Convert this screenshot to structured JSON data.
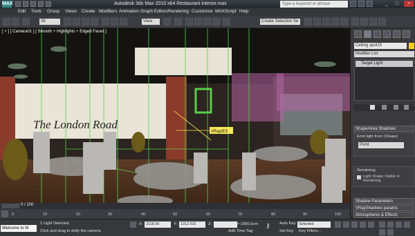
{
  "window": {
    "title": "Autodesk 3ds Max  2010 x64      Restaurant interior.max",
    "search_placeholder": "Type a keyword or phrase",
    "logo_label": "MAX"
  },
  "menu": [
    "Edit",
    "Tools",
    "Group",
    "Views",
    "Create",
    "Modifiers",
    "Animation",
    "Graph Editors",
    "Rendering",
    "Customize",
    "MAXScript",
    "Help"
  ],
  "toolbar": {
    "selection_filter": "All",
    "reference_coord": "View",
    "named_selection": "Create Selection Se"
  },
  "viewport": {
    "label": "[ + ] [ Camera01 ] [ Smooth + Highlights + Edged Faces ]",
    "sign_text": "The London Road",
    "object_tag": "VRayIES"
  },
  "command_panel": {
    "object_name": "Ceiling spot15",
    "modifier_list": "Modifier List",
    "stack_item": "Target Light",
    "rollouts": {
      "shape_area_shadows": "Shape/Area Shadows",
      "emit_light_from": "Emit light from (Shape)",
      "shape_type": "Point",
      "rendering": "Rendering",
      "light_shape_visible": "Light Shape Visible in Rendering",
      "shadow_parameters": "Shadow Parameters",
      "vray_shadows": "VRayShadows params",
      "atmospheres": "Atmospheres & Effects"
    },
    "object_color": "#f4d21c"
  },
  "timeline": {
    "frame_counter": "0 / 100",
    "ticks": [
      "0",
      "10",
      "20",
      "30",
      "40",
      "50",
      "60",
      "70",
      "80",
      "90",
      "100"
    ]
  },
  "status": {
    "maxscript_text": "Welcome to M",
    "selection": "1 Light Selected",
    "prompt": "Click and drag to dolly the camera",
    "x_value": "2118.05",
    "y_value": "1312.531",
    "z_value": "",
    "grid": "Grid = 1000.0cm",
    "add_time_tag": "Add Time Tag",
    "auto_key": "Auto Key",
    "set_key": "Set Key",
    "selected": "Selected",
    "key_filters": "Key Filters..."
  }
}
